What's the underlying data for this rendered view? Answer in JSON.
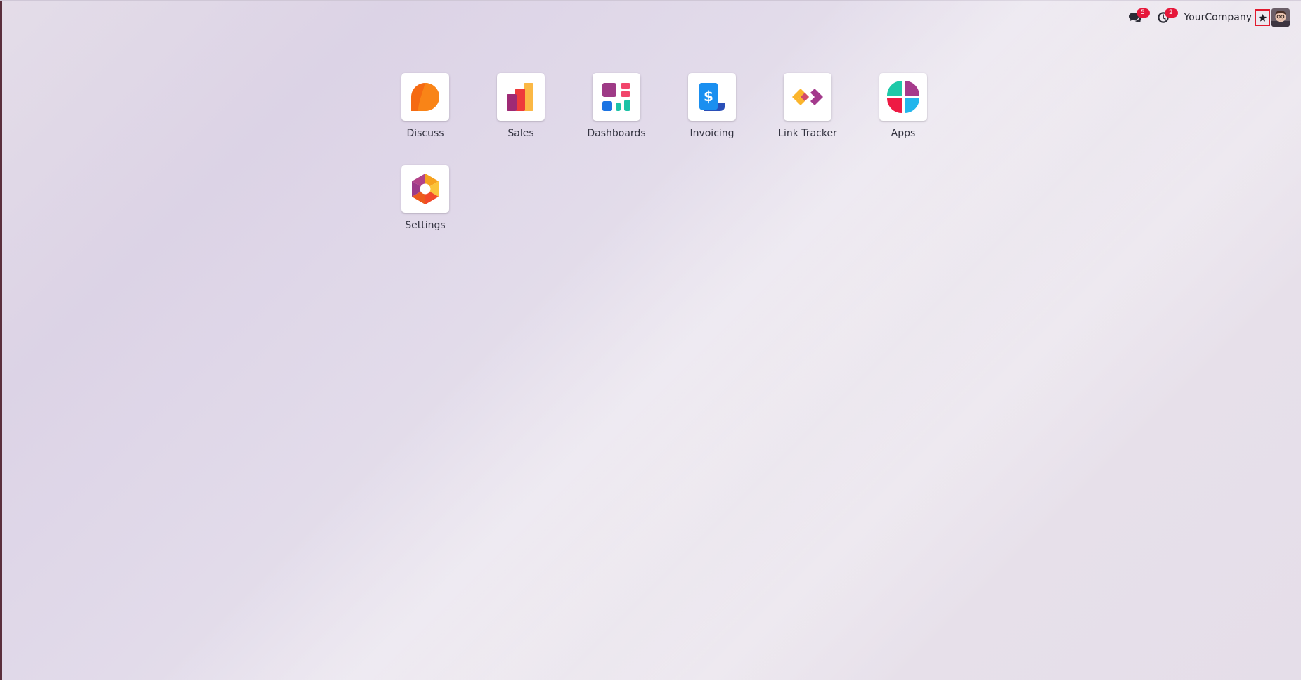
{
  "topbar": {
    "messages": {
      "icon": "chat-bubbles-icon",
      "count": "5"
    },
    "activities": {
      "icon": "clock-icon",
      "count": "2"
    },
    "company_name": "YourCompany",
    "favorite": {
      "icon": "star-icon"
    },
    "user": {
      "icon": "avatar-icon"
    }
  },
  "apps": [
    {
      "label": "Discuss",
      "icon": "discuss-icon"
    },
    {
      "label": "Sales",
      "icon": "sales-icon"
    },
    {
      "label": "Dashboards",
      "icon": "dashboards-icon"
    },
    {
      "label": "Invoicing",
      "icon": "invoicing-icon"
    },
    {
      "label": "Link Tracker",
      "icon": "link-tracker-icon"
    },
    {
      "label": "Apps",
      "icon": "apps-icon"
    },
    {
      "label": "Settings",
      "icon": "settings-icon"
    }
  ],
  "colors": {
    "badge": "#e6173a",
    "highlight": "#e11a2e",
    "text": "#333340"
  }
}
